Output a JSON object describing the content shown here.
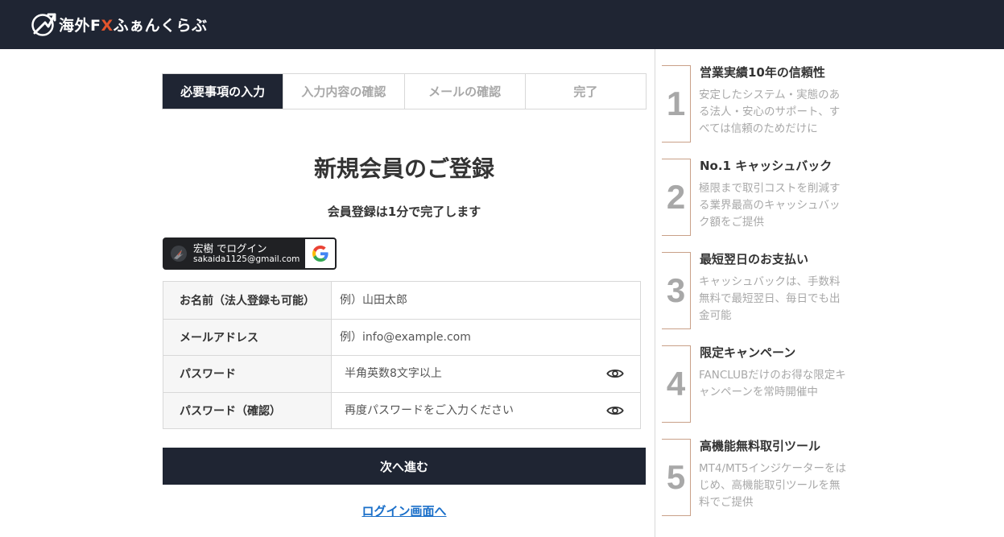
{
  "header": {
    "logo_prefix": "海外F",
    "logo_x": "X",
    "logo_suffix": "ふぁんくらぶ"
  },
  "steps": [
    "必要事項の入力",
    "入力内容の確認",
    "メールの確認",
    "完了"
  ],
  "page_title": "新規会員のご登録",
  "subtitle": "会員登録は1分で完了します",
  "google": {
    "name": "宏樹 でログイン",
    "email": "sakaida1125@gmail.com"
  },
  "form": {
    "fields": [
      {
        "label": "お名前（法人登録も可能）",
        "placeholder": "例）山田太郎"
      },
      {
        "label": "メールアドレス",
        "placeholder": "例）info@example.com"
      },
      {
        "label": "パスワード",
        "placeholder": "半角英数8文字以上"
      },
      {
        "label": "パスワード（確認）",
        "placeholder": "再度パスワードをご入力ください"
      }
    ]
  },
  "next_button": "次へ進む",
  "login_link": "ログイン画面へ",
  "features": [
    {
      "num": "1",
      "title": "営業実績10年の信頼性",
      "desc": "安定したシステム・実態のある法人・安心のサポート、すべては信頼のためだけに"
    },
    {
      "num": "2",
      "title": "No.1 キャッシュバック",
      "desc": "極限まで取引コストを削減する業界最高のキャッシュバック額をご提供"
    },
    {
      "num": "3",
      "title": "最短翌日のお支払い",
      "desc": "キャッシュバックは、手数料無料で最短翌日、毎日でも出金可能"
    },
    {
      "num": "4",
      "title": "限定キャンペーン",
      "desc": "FANCLUBだけのお得な限定キャンペーンを常時開催中"
    },
    {
      "num": "5",
      "title": "高機能無料取引ツール",
      "desc": "MT4/MT5インジケーターをはじめ、高機能取引ツールを無料でご提供"
    }
  ],
  "colors": {
    "navy": "#1f2533",
    "accent": "#e2542c",
    "link": "#1a6fc9"
  }
}
